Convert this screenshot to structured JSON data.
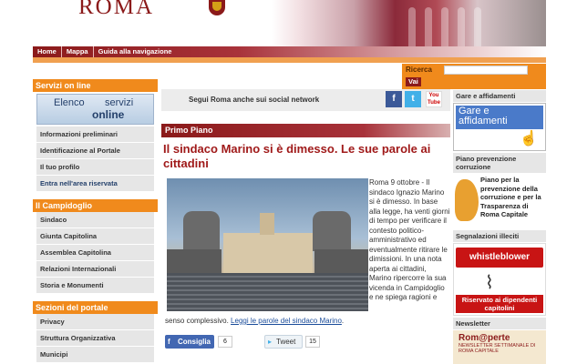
{
  "header": {
    "logo": "ROMA",
    "nav": [
      "Home",
      "Mappa",
      "Guida alla navigazione"
    ]
  },
  "search": {
    "label": "Ricerca",
    "button": "Vai",
    "placeholder": ""
  },
  "left": {
    "servizi_title": "Servizi on line",
    "servizi_box": {
      "l1": "Elenco",
      "l2": "servizi",
      "l3": "online"
    },
    "servizi_items": [
      "Informazioni preliminari",
      "Identificazione al Portale",
      "Il tuo profilo",
      "Entra nell'area riservata"
    ],
    "campidoglio_title": "Il Campidoglio",
    "campidoglio_items": [
      "Sindaco",
      "Giunta Capitolina",
      "Assemblea Capitolina",
      "Relazioni Internazionali",
      "Storia e Monumenti"
    ],
    "portale_title": "Sezioni del portale",
    "portale_items": [
      "Privacy",
      "Struttura Organizzativa",
      "Municipi"
    ]
  },
  "center": {
    "social_text": "Segui Roma anche sui social network",
    "youtube_label": "You Tube",
    "primo_piano": "Primo Piano",
    "headline": "Il sindaco Marino si è dimesso. Le sue parole ai cittadini",
    "article_side": "Roma 9 ottobre - Il sindaco Ignazio Marino si è dimesso. In base alla legge, ha venti giorni di tempo per verificare il contesto politico-amministrativo ed eventualmente ritirare le dimissioni. In una nota aperta ai cittadini, Marino ripercorre la sua vicenda in Campidoglio e ne spiega ragioni e",
    "article_cont": "senso complessivo.",
    "article_link": "Leggi le parole del sindaco Marino",
    "fb_label": "Consiglia",
    "fb_count": "6",
    "tw_label": "Tweet",
    "tw_count": "15"
  },
  "right": {
    "gare_title": "Gare e affidamenti",
    "gare_box_text": "Gare e affidamenti",
    "prev_title": "Piano prevenzione corruzione",
    "prev_text": "Piano per la prevenzione della corruzione e per la Trasparenza di Roma Capitale",
    "segn_title": "Segnalazioni illeciti",
    "whistle_label": "whistleblower",
    "whistle_bottom": "Riservato ai dipendenti capitolini",
    "news_title": "Newsletter",
    "news_t1": "Rom@perte",
    "news_t2": "NEWSLETTER SETTIMANALE DI ROMA CAPITALE"
  }
}
